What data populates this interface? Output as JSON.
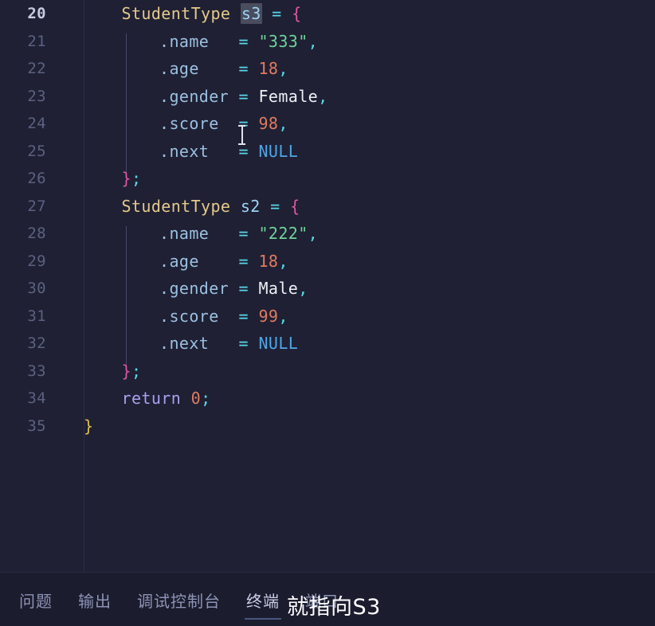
{
  "editor": {
    "language": "c",
    "first_line_number": 20,
    "active_line_number": 20,
    "highlighted_symbol": "s3",
    "colors": {
      "background": "#1f2034",
      "line_number": "#5b6180",
      "line_number_active": "#c8cce0",
      "type": "#e4c98a",
      "variable": "#9cd4f5",
      "operator": "#59d7e8",
      "brace": "#e255a1",
      "property": "#9cc0e0",
      "string": "#6fd49a",
      "number": "#e07a5f",
      "enum_member": "#eceff4",
      "macro": "#4fa6e8",
      "keyword": "#a9a0ee",
      "function_brace": "#e0c04a",
      "selection_highlight": "#4a4d5e"
    },
    "lines": [
      {
        "n": "20",
        "indent": 1,
        "tokens": [
          {
            "t": "StudentType",
            "c": "t-type"
          },
          {
            "t": " ",
            "c": "t-plain"
          },
          {
            "t": "s3",
            "c": "t-var",
            "hl": true
          },
          {
            "t": " ",
            "c": "t-plain"
          },
          {
            "t": "=",
            "c": "t-op"
          },
          {
            "t": " ",
            "c": "t-plain"
          },
          {
            "t": "{",
            "c": "t-brace"
          }
        ]
      },
      {
        "n": "21",
        "indent": 2,
        "tokens": [
          {
            "t": ".name",
            "c": "t-prop"
          },
          {
            "t": "   ",
            "c": "t-plain"
          },
          {
            "t": "=",
            "c": "t-op"
          },
          {
            "t": " ",
            "c": "t-plain"
          },
          {
            "t": "\"333\"",
            "c": "t-str"
          },
          {
            "t": ",",
            "c": "t-punc"
          }
        ]
      },
      {
        "n": "22",
        "indent": 2,
        "tokens": [
          {
            "t": ".age",
            "c": "t-prop"
          },
          {
            "t": "    ",
            "c": "t-plain"
          },
          {
            "t": "=",
            "c": "t-op"
          },
          {
            "t": " ",
            "c": "t-plain"
          },
          {
            "t": "18",
            "c": "t-num"
          },
          {
            "t": ",",
            "c": "t-punc"
          }
        ]
      },
      {
        "n": "23",
        "indent": 2,
        "tokens": [
          {
            "t": ".gender",
            "c": "t-prop"
          },
          {
            "t": " ",
            "c": "t-plain"
          },
          {
            "t": "=",
            "c": "t-op"
          },
          {
            "t": " ",
            "c": "t-plain"
          },
          {
            "t": "Female",
            "c": "t-enum"
          },
          {
            "t": ",",
            "c": "t-punc"
          }
        ]
      },
      {
        "n": "24",
        "indent": 2,
        "tokens": [
          {
            "t": ".score",
            "c": "t-prop"
          },
          {
            "t": "  ",
            "c": "t-plain"
          },
          {
            "t": "=",
            "c": "t-op"
          },
          {
            "t": " ",
            "c": "t-plain"
          },
          {
            "t": "98",
            "c": "t-num"
          },
          {
            "t": ",",
            "c": "t-punc"
          }
        ]
      },
      {
        "n": "25",
        "indent": 2,
        "tokens": [
          {
            "t": ".next",
            "c": "t-prop"
          },
          {
            "t": "   ",
            "c": "t-plain"
          },
          {
            "t": "=",
            "c": "t-op"
          },
          {
            "t": " ",
            "c": "t-plain"
          },
          {
            "t": "NULL",
            "c": "t-macro"
          }
        ]
      },
      {
        "n": "26",
        "indent": 1,
        "tokens": [
          {
            "t": "}",
            "c": "t-brace"
          },
          {
            "t": ";",
            "c": "t-punc"
          }
        ]
      },
      {
        "n": "27",
        "indent": 1,
        "tokens": [
          {
            "t": "StudentType",
            "c": "t-type"
          },
          {
            "t": " ",
            "c": "t-plain"
          },
          {
            "t": "s2",
            "c": "t-var"
          },
          {
            "t": " ",
            "c": "t-plain"
          },
          {
            "t": "=",
            "c": "t-op"
          },
          {
            "t": " ",
            "c": "t-plain"
          },
          {
            "t": "{",
            "c": "t-brace"
          }
        ]
      },
      {
        "n": "28",
        "indent": 2,
        "tokens": [
          {
            "t": ".name",
            "c": "t-prop"
          },
          {
            "t": "   ",
            "c": "t-plain"
          },
          {
            "t": "=",
            "c": "t-op"
          },
          {
            "t": " ",
            "c": "t-plain"
          },
          {
            "t": "\"222\"",
            "c": "t-str"
          },
          {
            "t": ",",
            "c": "t-punc"
          }
        ]
      },
      {
        "n": "29",
        "indent": 2,
        "tokens": [
          {
            "t": ".age",
            "c": "t-prop"
          },
          {
            "t": "    ",
            "c": "t-plain"
          },
          {
            "t": "=",
            "c": "t-op"
          },
          {
            "t": " ",
            "c": "t-plain"
          },
          {
            "t": "18",
            "c": "t-num"
          },
          {
            "t": ",",
            "c": "t-punc"
          }
        ]
      },
      {
        "n": "30",
        "indent": 2,
        "tokens": [
          {
            "t": ".gender",
            "c": "t-prop"
          },
          {
            "t": " ",
            "c": "t-plain"
          },
          {
            "t": "=",
            "c": "t-op"
          },
          {
            "t": " ",
            "c": "t-plain"
          },
          {
            "t": "Male",
            "c": "t-enum"
          },
          {
            "t": ",",
            "c": "t-punc"
          }
        ]
      },
      {
        "n": "31",
        "indent": 2,
        "tokens": [
          {
            "t": ".score",
            "c": "t-prop"
          },
          {
            "t": "  ",
            "c": "t-plain"
          },
          {
            "t": "=",
            "c": "t-op"
          },
          {
            "t": " ",
            "c": "t-plain"
          },
          {
            "t": "99",
            "c": "t-num"
          },
          {
            "t": ",",
            "c": "t-punc"
          }
        ]
      },
      {
        "n": "32",
        "indent": 2,
        "tokens": [
          {
            "t": ".next",
            "c": "t-prop"
          },
          {
            "t": "   ",
            "c": "t-plain"
          },
          {
            "t": "=",
            "c": "t-op"
          },
          {
            "t": " ",
            "c": "t-plain"
          },
          {
            "t": "NULL",
            "c": "t-macro"
          }
        ]
      },
      {
        "n": "33",
        "indent": 1,
        "tokens": [
          {
            "t": "}",
            "c": "t-brace"
          },
          {
            "t": ";",
            "c": "t-punc"
          }
        ]
      },
      {
        "n": "34",
        "indent": 1,
        "tokens": [
          {
            "t": "return",
            "c": "t-kw"
          },
          {
            "t": " ",
            "c": "t-plain"
          },
          {
            "t": "0",
            "c": "t-num"
          },
          {
            "t": ";",
            "c": "t-punc"
          }
        ]
      },
      {
        "n": "35",
        "indent": 0,
        "tokens": [
          {
            "t": "}",
            "c": "t-fbrace"
          }
        ]
      }
    ]
  },
  "panel": {
    "tabs": [
      {
        "label": "问题",
        "active": false
      },
      {
        "label": "输出",
        "active": false
      },
      {
        "label": "调试控制台",
        "active": false
      },
      {
        "label": "终端",
        "active": true
      },
      {
        "label": "端口",
        "active": false
      }
    ]
  },
  "annotation": {
    "text": "就指向S3",
    "color": "#ffffff"
  }
}
